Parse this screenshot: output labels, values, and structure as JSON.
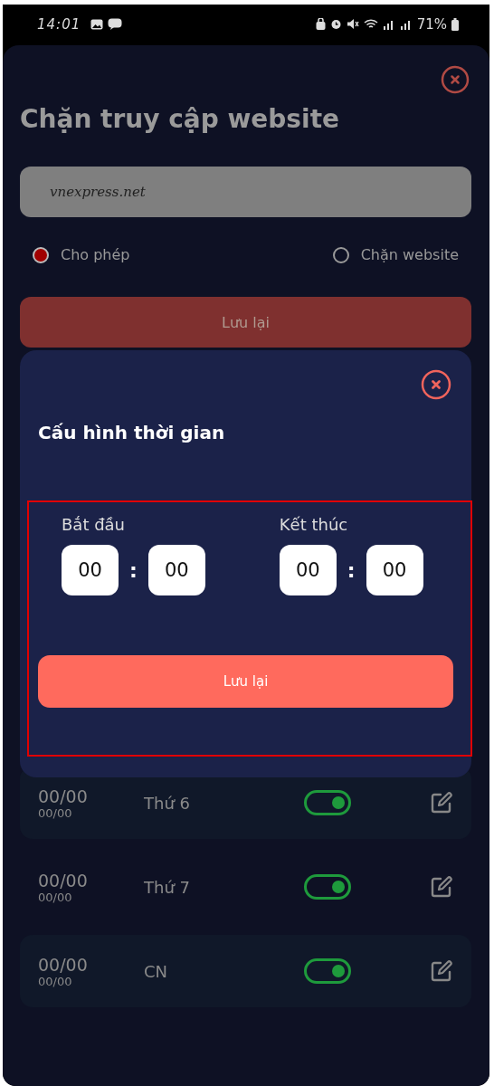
{
  "status_bar": {
    "time": "14:01",
    "battery": "71%"
  },
  "page": {
    "title": "Chặn truy cập website",
    "url_field": {
      "value": "vnexpress.net"
    },
    "modes": [
      {
        "label": "Cho phép",
        "selected": true
      },
      {
        "label": "Chặn website",
        "selected": false
      }
    ],
    "save_button": "Lưu lại"
  },
  "schedule": [
    {
      "start": "00/00",
      "end": "00/00",
      "day": "Thứ 6",
      "on": true
    },
    {
      "start": "00/00",
      "end": "00/00",
      "day": "Thứ 7",
      "on": true
    },
    {
      "start": "00/00",
      "end": "00/00",
      "day": "CN",
      "on": true
    }
  ],
  "dialog": {
    "title": "Cấu hình thời gian",
    "groups": [
      {
        "label": "Bắt đầu",
        "hour": "00",
        "separator": ":",
        "minute": "00"
      },
      {
        "label": "Kết thúc",
        "hour": "00",
        "separator": ":",
        "minute": "00"
      }
    ],
    "save_button": "Lưu lại"
  }
}
